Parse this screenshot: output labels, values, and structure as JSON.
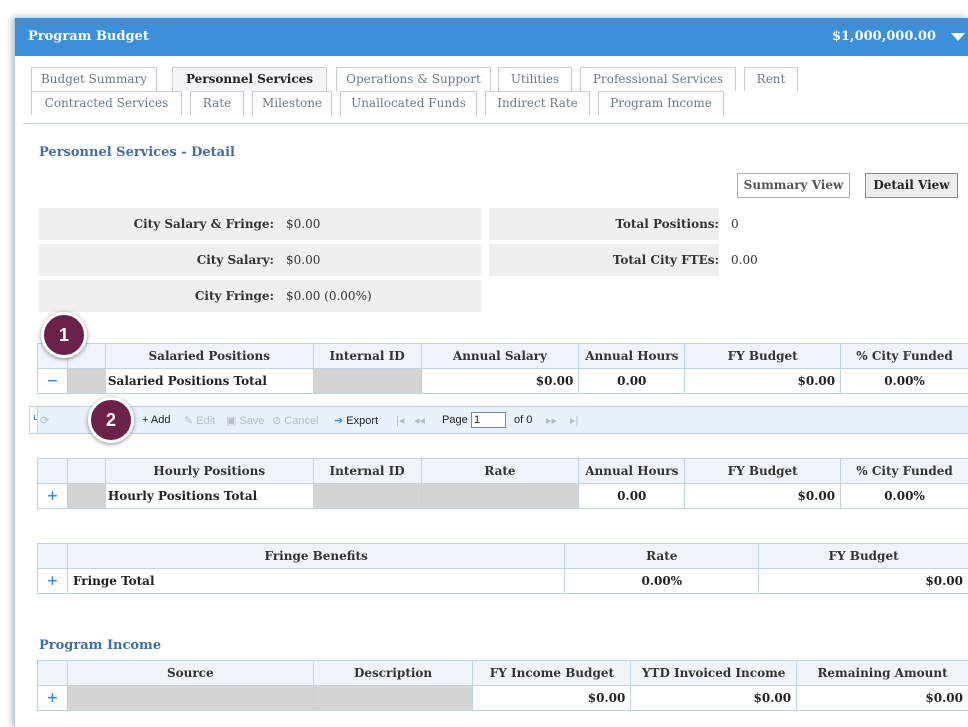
{
  "header": {
    "title": "Program Budget",
    "amount": "$1,000,000.00"
  },
  "tabs_row1": [
    {
      "label": "Budget Summary",
      "active": false
    },
    {
      "label": "Personnel Services",
      "active": true
    },
    {
      "label": "Operations & Support",
      "active": false
    },
    {
      "label": "Utilities",
      "active": false
    },
    {
      "label": "Professional Services",
      "active": false
    },
    {
      "label": "Rent",
      "active": false
    }
  ],
  "tabs_row2": [
    {
      "label": "Contracted Services"
    },
    {
      "label": "Rate"
    },
    {
      "label": "Milestone"
    },
    {
      "label": "Unallocated Funds"
    },
    {
      "label": "Indirect Rate"
    },
    {
      "label": "Program Income"
    }
  ],
  "detail": {
    "title": "Personnel Services - Detail",
    "summary_view": "Summary View",
    "detail_view": "Detail View",
    "city_salary_fringe_label": "City Salary & Fringe:",
    "city_salary_fringe_value": "$0.00",
    "city_salary_label": "City Salary:",
    "city_salary_value": "$0.00",
    "city_fringe_label": "City Fringe:",
    "city_fringe_value": "$0.00 (0.00%)",
    "total_positions_label": "Total Positions:",
    "total_positions_value": "0",
    "total_ftes_label": "Total City FTEs:",
    "total_ftes_value": "0.00"
  },
  "salaried": {
    "headers": [
      "Salaried Positions",
      "Internal ID",
      "Annual Salary",
      "Annual Hours",
      "FY Budget",
      "% City Funded"
    ],
    "expand": "−",
    "total_label": "Salaried Positions Total",
    "annual_salary": "$0.00",
    "annual_hours": "0.00",
    "fy_budget": "$0.00",
    "pct_funded": "0.00%"
  },
  "toolbar": {
    "add": "Add",
    "edit": "Edit",
    "save": "Save",
    "cancel": "Cancel",
    "export": "Export",
    "page_label": "Page",
    "page_value": "1",
    "of_label": "of 0"
  },
  "hourly": {
    "headers": [
      "Hourly Positions",
      "Internal ID",
      "Rate",
      "Annual Hours",
      "FY Budget",
      "% City Funded"
    ],
    "expand": "+",
    "total_label": "Hourly Positions Total",
    "annual_hours": "0.00",
    "fy_budget": "$0.00",
    "pct_funded": "0.00%"
  },
  "fringe": {
    "headers": [
      "Fringe Benefits",
      "Rate",
      "FY Budget"
    ],
    "expand": "+",
    "total_label": "Fringe Total",
    "rate": "0.00%",
    "fy_budget": "$0.00"
  },
  "program_income": {
    "title": "Program Income",
    "headers": [
      "Source",
      "Description",
      "FY Income Budget",
      "YTD Invoiced Income",
      "Remaining Amount"
    ],
    "expand": "+",
    "fy_income_budget": "$0.00",
    "ytd_invoiced": "$0.00",
    "remaining": "$0.00"
  },
  "badges": [
    "1",
    "2"
  ],
  "colors": {
    "header_blue": "#3c8fd9",
    "section_title": "#3f6fa6",
    "badge": "#6b2149"
  }
}
